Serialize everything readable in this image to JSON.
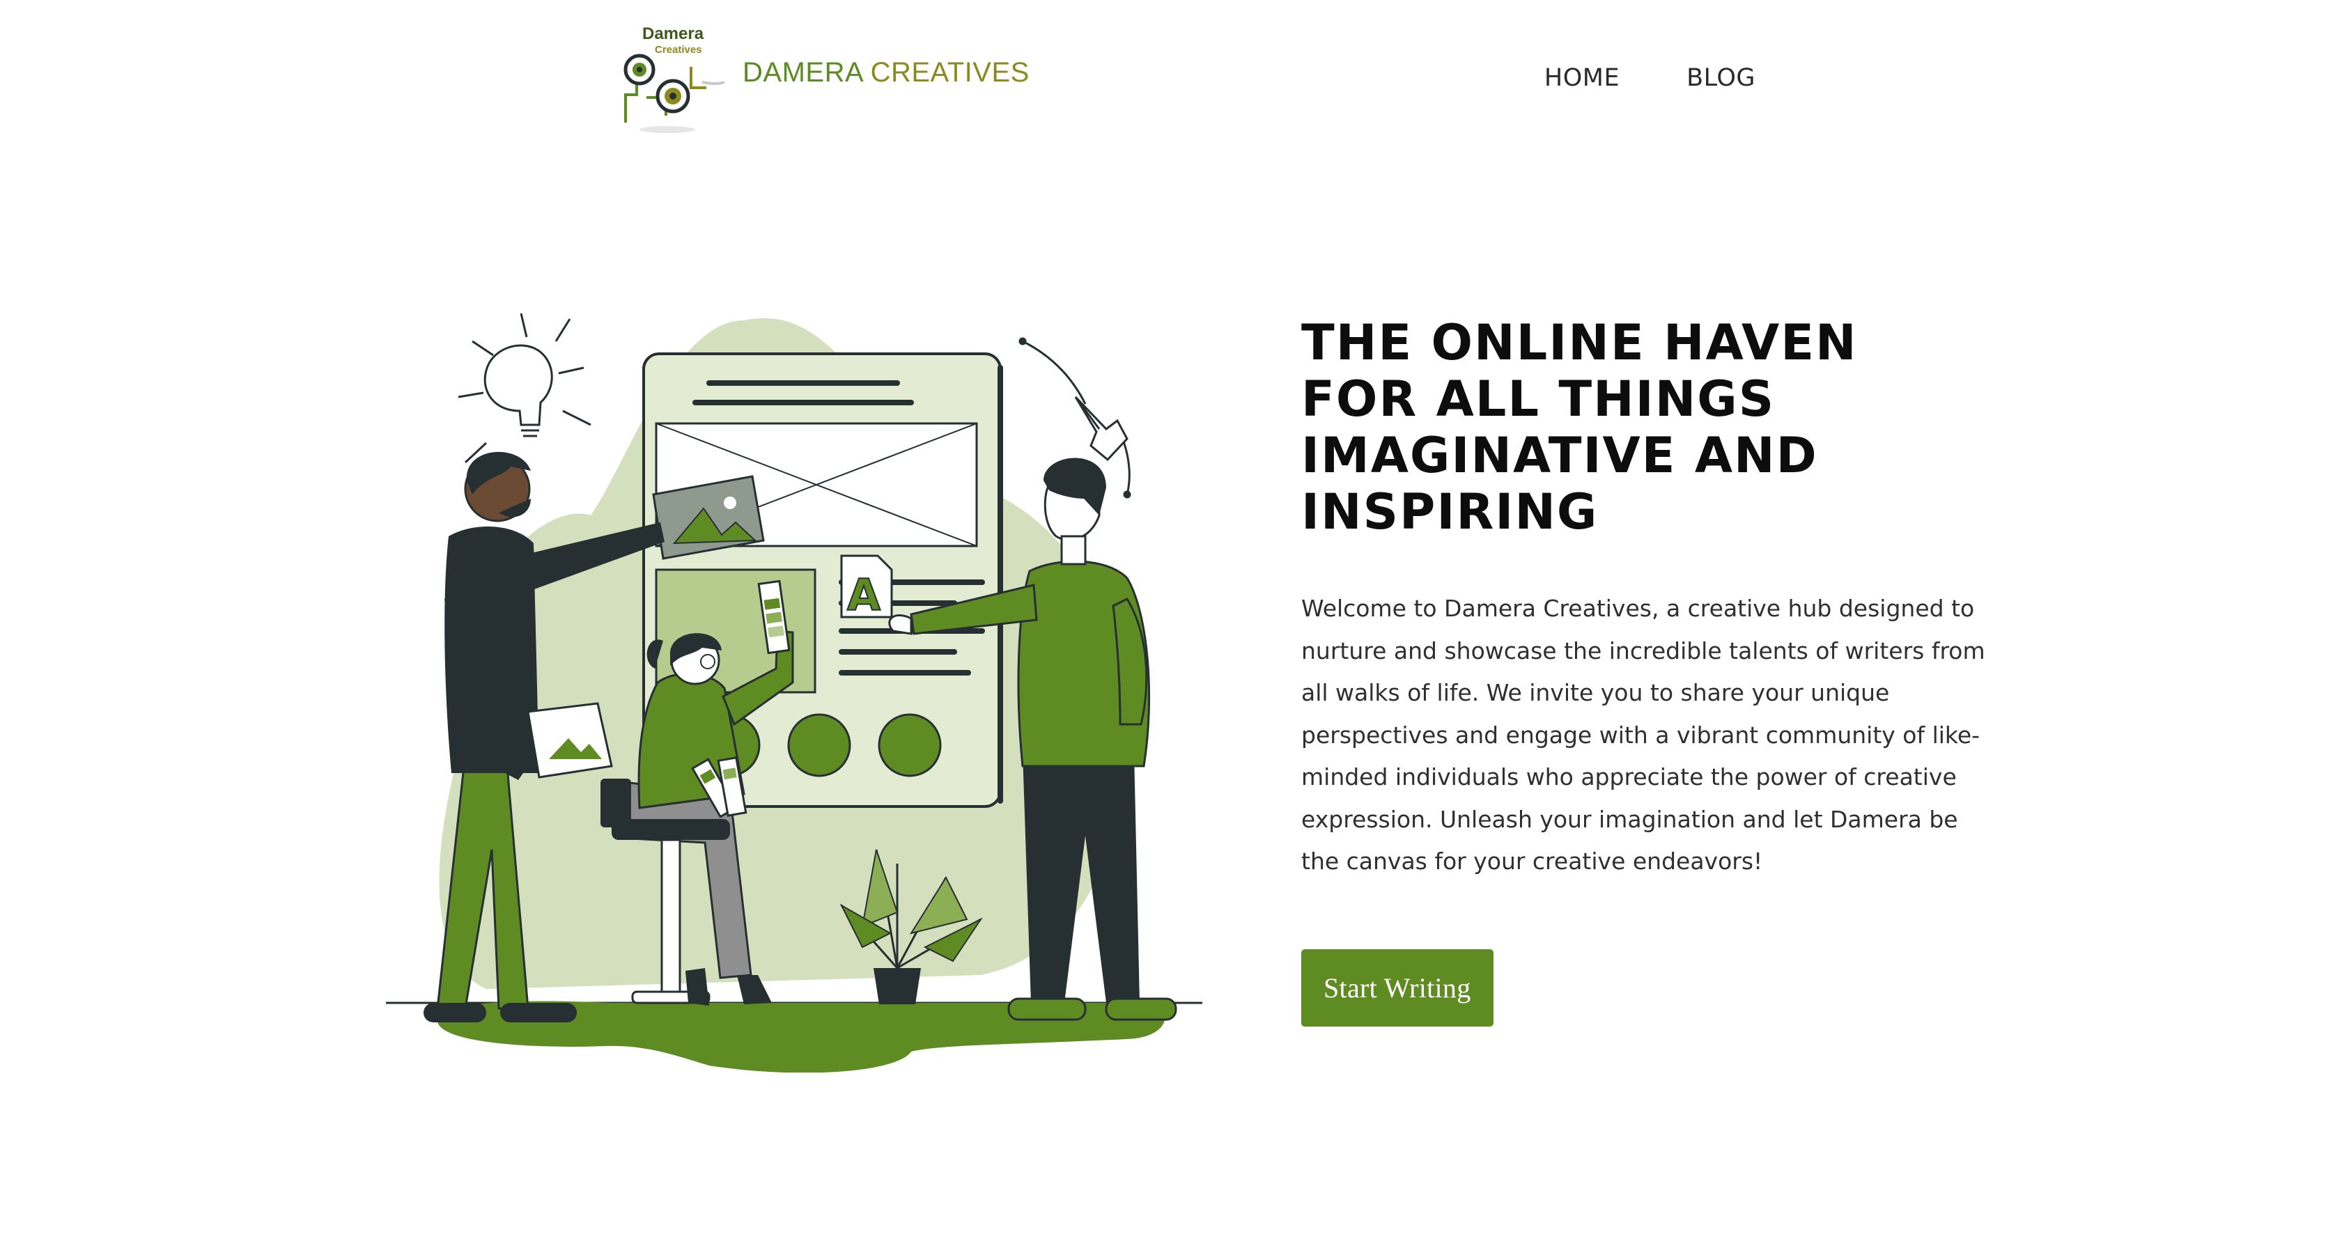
{
  "header": {
    "logo": {
      "mark_text_line1": "Damera",
      "mark_text_line2": "Creatives",
      "word1": "DAMERA",
      "word2": "CREATIVES"
    },
    "nav": [
      {
        "label": "HOME"
      },
      {
        "label": "BLOG"
      }
    ]
  },
  "hero": {
    "title": "THE ONLINE HAVEN FOR ALL THINGS IMAGINATIVE AND INSPIRING",
    "description": "Welcome to Damera Creatives, a creative hub designed to nurture and showcase the incredible talents of writers from all walks of life. We invite you to share your unique perspectives and engage with a vibrant community of like-minded individuals who appreciate the power of creative expression. Unleash your imagination and let Damera be the canvas for your creative endeavors!",
    "cta_label": "Start Writing",
    "illustration_letter": "A"
  },
  "colors": {
    "brand_green": "#5f8b23",
    "brand_olive": "#8c8a1f",
    "light_green": "#d3dfbd",
    "dark": "#263032"
  },
  "icons": [
    "lightbulb-icon",
    "pen-tool-icon",
    "image-placeholder-icon",
    "plant-icon"
  ]
}
